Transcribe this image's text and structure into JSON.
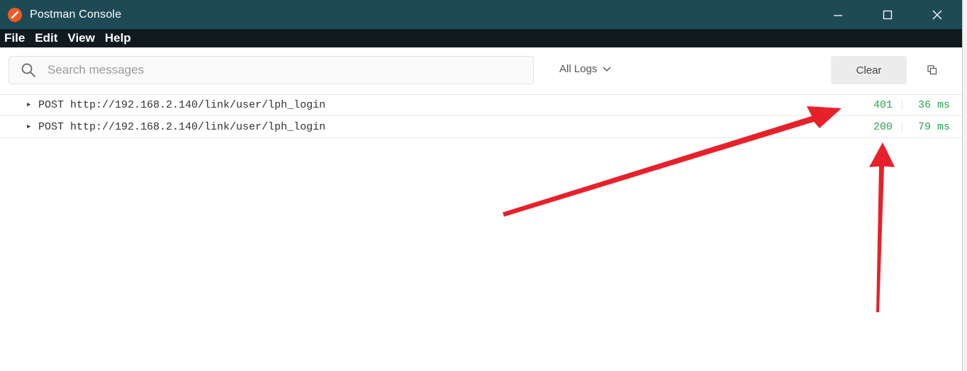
{
  "window": {
    "title": "Postman Console"
  },
  "menu": {
    "items": [
      "File",
      "Edit",
      "View",
      "Help"
    ]
  },
  "toolbar": {
    "search_placeholder": "Search messages",
    "log_filter": "All Logs",
    "clear_label": "Clear"
  },
  "logs": [
    {
      "method": "POST",
      "url": "http://192.168.2.140/link/user/lph_login",
      "status": "401",
      "time": "36 ms"
    },
    {
      "method": "POST",
      "url": "http://192.168.2.140/link/user/lph_login",
      "status": "200",
      "time": "79 ms"
    }
  ],
  "colors": {
    "titlebar": "#1e4a56",
    "menubar": "#0f1b1f",
    "status_green": "#2aa352",
    "annotation_red": "#e8202a",
    "postman_orange": "#ef5b25"
  },
  "icons": {
    "app": "postman-logo-icon",
    "search": "search-icon",
    "dropdown": "chevron-down-icon",
    "copy": "copy-icon",
    "expand": "caret-right-icon"
  }
}
